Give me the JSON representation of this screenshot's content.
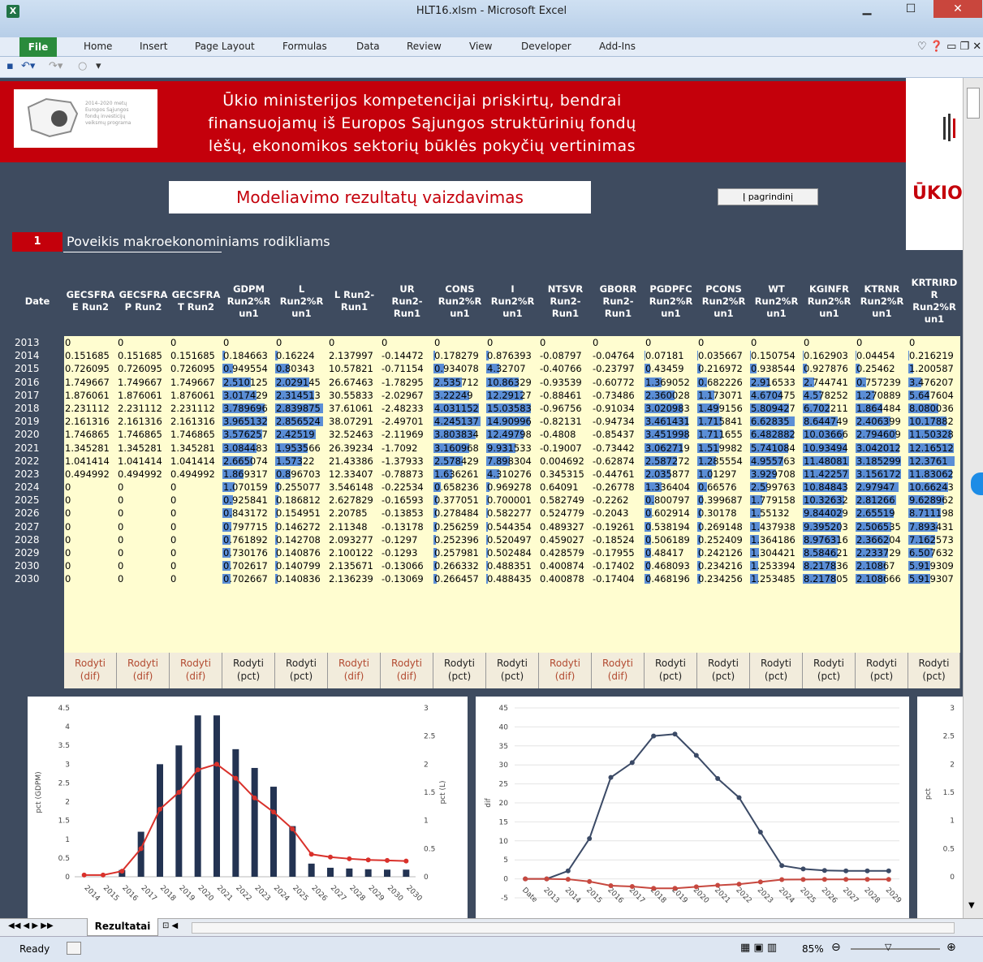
{
  "window": {
    "title": "HLT16.xlsm  -  Microsoft Excel"
  },
  "ribbon": {
    "file": "File",
    "tabs": [
      "Home",
      "Insert",
      "Page Layout",
      "Formulas",
      "Data",
      "Review",
      "View",
      "Developer",
      "Add-Ins"
    ]
  },
  "banner": {
    "logo_text": "2014–2020 metų\nEuropos Sąjungos\nfondų investicijų\nveiksmų programa",
    "title_line1": "Ūkio ministerijos kompetencijai priskirtų, bendrai",
    "title_line2": "finansuojamų iš Europos Sąjungos struktūrinių fondų",
    "title_line3": "lėšų, ekonomikos sektorių būklės pokyčių vertinimas",
    "right_logo_text": "ŪKIO"
  },
  "subtitle": "Modeliavimo rezultatų vaizdavimas",
  "back_button": "Į pagrindinį",
  "section": {
    "number": "1",
    "title": "Poveikis makroekonominiams rodikliams"
  },
  "table": {
    "date_header": "Date",
    "columns": [
      "GECSFRA\nE   Run2",
      "GECSFRA\nP    Run2",
      "GECSFRA\nT    Run2",
      "GDPM\nRun2%R\nun1",
      "L\nRun2%R\nun1",
      "L    Run2-\nRun1",
      "UR\nRun2-\nRun1",
      "CONS\nRun2%R\nun1",
      "I\nRun2%R\nun1",
      "NTSVR\nRun2-\nRun1",
      "GBORR\nRun2-\nRun1",
      "PGDPFC\nRun2%R\nun1",
      "PCONS\nRun2%R\nun1",
      "WT\nRun2%R\nun1",
      "KGINFR\nRun2%R\nun1",
      "KTRNR\nRun2%R\nun1",
      "KRTRIRD\nR\nRun2%R\nun1"
    ],
    "dates": [
      "2013",
      "2014",
      "2015",
      "2016",
      "2017",
      "2018",
      "2019",
      "2020",
      "2021",
      "2022",
      "2023",
      "2024",
      "2025",
      "2026",
      "2027",
      "2028",
      "2029",
      "2030",
      "2030"
    ],
    "rows": [
      [
        "0",
        "0",
        "0",
        "0",
        "0",
        "0",
        "0",
        "0",
        "0",
        "0",
        "0",
        "0",
        "0",
        "0",
        "0",
        "0",
        "0"
      ],
      [
        "0.151685",
        "0.151685",
        "0.151685",
        "0.184663",
        "0.16224",
        "2.137997",
        "-0.14472",
        "0.178279",
        "0.876393",
        "-0.08797",
        "-0.04764",
        "0.07181",
        "0.035667",
        "0.150754",
        "0.162903",
        "0.04454",
        "0.216219"
      ],
      [
        "0.726095",
        "0.726095",
        "0.726095",
        "0.949554",
        "0.80343",
        "10.57821",
        "-0.71154",
        "0.934078",
        "4.32707",
        "-0.40766",
        "-0.23797",
        "0.43459",
        "0.216972",
        "0.938544",
        "0.927876",
        "0.25462",
        "1.200587"
      ],
      [
        "1.749667",
        "1.749667",
        "1.749667",
        "2.510125",
        "2.029145",
        "26.67463",
        "-1.78295",
        "2.535712",
        "10.86329",
        "-0.93539",
        "-0.60772",
        "1.369052",
        "0.682226",
        "2.916533",
        "2.744741",
        "0.757239",
        "3.476207"
      ],
      [
        "1.876061",
        "1.876061",
        "1.876061",
        "3.017429",
        "2.314513",
        "30.55833",
        "-2.02967",
        "3.22249",
        "12.29127",
        "-0.88461",
        "-0.73486",
        "2.360028",
        "1.173071",
        "4.670475",
        "4.578252",
        "1.270889",
        "5.647604"
      ],
      [
        "2.231112",
        "2.231112",
        "2.231112",
        "3.789696",
        "2.839875",
        "37.61061",
        "-2.48233",
        "4.031152",
        "15.03583",
        "-0.96756",
        "-0.91034",
        "3.020983",
        "1.499156",
        "5.809427",
        "6.702211",
        "1.864484",
        "8.080036"
      ],
      [
        "2.161316",
        "2.161316",
        "2.161316",
        "3.965132",
        "2.856524",
        "38.07291",
        "-2.49701",
        "4.245137",
        "14.90996",
        "-0.82131",
        "-0.94734",
        "3.461431",
        "1.715841",
        "6.62835",
        "8.644749",
        "2.406399",
        "10.17882"
      ],
      [
        "1.746865",
        "1.746865",
        "1.746865",
        "3.576257",
        "2.42519",
        "32.52463",
        "-2.11969",
        "3.803834",
        "12.49798",
        "-0.4808",
        "-0.85437",
        "3.451998",
        "1.711655",
        "6.482882",
        "10.03666",
        "2.794609",
        "11.50328"
      ],
      [
        "1.345281",
        "1.345281",
        "1.345281",
        "3.084483",
        "1.953566",
        "26.39234",
        "-1.7092",
        "3.160968",
        "9.931533",
        "-0.19007",
        "-0.73442",
        "3.062719",
        "1.519982",
        "5.741084",
        "10.93494",
        "3.042012",
        "12.16512"
      ],
      [
        "1.041414",
        "1.041414",
        "1.041414",
        "2.665074",
        "1.57322",
        "21.43386",
        "-1.37933",
        "2.578429",
        "7.898304",
        "0.004692",
        "-0.62874",
        "2.587272",
        "1.285554",
        "4.955763",
        "11.48081",
        "3.185299",
        "12.3761"
      ],
      [
        "0.494992",
        "0.494992",
        "0.494992",
        "1.869317",
        "0.896703",
        "12.33407",
        "-0.78873",
        "1.636261",
        "4.310276",
        "0.345315",
        "-0.44761",
        "2.035877",
        "1.01297",
        "3.929708",
        "11.42257",
        "3.156172",
        "11.83062"
      ],
      [
        "0",
        "0",
        "0",
        "1.070159",
        "0.255077",
        "3.546148",
        "-0.22534",
        "0.658236",
        "0.969278",
        "0.64091",
        "-0.26778",
        "1.336404",
        "0.66576",
        "2.599763",
        "10.84843",
        "2.97947",
        "10.66243"
      ],
      [
        "0",
        "0",
        "0",
        "0.925841",
        "0.186812",
        "2.627829",
        "-0.16593",
        "0.377051",
        "0.700001",
        "0.582749",
        "-0.2262",
        "0.800797",
        "0.399687",
        "1.779158",
        "10.32632",
        "2.81266",
        "9.628962"
      ],
      [
        "0",
        "0",
        "0",
        "0.843172",
        "0.154951",
        "2.20785",
        "-0.13853",
        "0.278484",
        "0.582277",
        "0.524779",
        "-0.2043",
        "0.602914",
        "0.30178",
        "1.55132",
        "9.844029",
        "2.65519",
        "8.711198"
      ],
      [
        "0",
        "0",
        "0",
        "0.797715",
        "0.146272",
        "2.11348",
        "-0.13178",
        "0.256259",
        "0.544354",
        "0.489327",
        "-0.19261",
        "0.538194",
        "0.269148",
        "1.437938",
        "9.395203",
        "2.506535",
        "7.893431"
      ],
      [
        "0",
        "0",
        "0",
        "0.761892",
        "0.142708",
        "2.093277",
        "-0.1297",
        "0.252396",
        "0.520497",
        "0.459027",
        "-0.18524",
        "0.506189",
        "0.252409",
        "1.364186",
        "8.976316",
        "2.366204",
        "7.162573"
      ],
      [
        "0",
        "0",
        "0",
        "0.730176",
        "0.140876",
        "2.100122",
        "-0.1293",
        "0.257981",
        "0.502484",
        "0.428579",
        "-0.17955",
        "0.48417",
        "0.242126",
        "1.304421",
        "8.584621",
        "2.233729",
        "6.507632"
      ],
      [
        "0",
        "0",
        "0",
        "0.702617",
        "0.140799",
        "2.135671",
        "-0.13066",
        "0.266332",
        "0.488351",
        "0.400874",
        "-0.17402",
        "0.468093",
        "0.234216",
        "1.253394",
        "8.217836",
        "2.10867",
        "5.919309"
      ],
      [
        "0",
        "0",
        "0",
        "0.702667",
        "0.140836",
        "2.136239",
        "-0.13069",
        "0.266457",
        "0.488435",
        "0.400878",
        "-0.17404",
        "0.468196",
        "0.234256",
        "1.253485",
        "8.217805",
        "2.108666",
        "5.919307"
      ]
    ],
    "bar_columns": [
      3,
      4,
      7,
      8,
      11,
      12,
      13,
      14,
      15,
      16
    ],
    "bar_scale": {
      "3": 4.5,
      "4": 3.0,
      "7": 4.5,
      "8": 17,
      "11": 4,
      "12": 3.5,
      "13": 7.5,
      "14": 12.5,
      "15": 3.5,
      "16": 13.5
    },
    "bar_color": "#5b8ed6",
    "buttons": [
      [
        "Rodyti",
        "(dif)"
      ],
      [
        "Rodyti",
        "(dif)"
      ],
      [
        "Rodyti",
        "(dif)"
      ],
      [
        "Rodyti",
        "(pct)"
      ],
      [
        "Rodyti",
        "(pct)"
      ],
      [
        "Rodyti",
        "(dif)"
      ],
      [
        "Rodyti",
        "(dif)"
      ],
      [
        "Rodyti",
        "(pct)"
      ],
      [
        "Rodyti",
        "(pct)"
      ],
      [
        "Rodyti",
        "(dif)"
      ],
      [
        "Rodyti",
        "(dif)"
      ],
      [
        "Rodyti",
        "(pct)"
      ],
      [
        "Rodyti",
        "(pct)"
      ],
      [
        "Rodyti",
        "(pct)"
      ],
      [
        "Rodyti",
        "(pct)"
      ],
      [
        "Rodyti",
        "(pct)"
      ],
      [
        "Rodyti",
        "(pct)"
      ]
    ]
  },
  "chart_data": [
    {
      "type": "bar",
      "categories": [
        "2014",
        "2015",
        "2016",
        "2017",
        "2018",
        "2019",
        "2020",
        "2021",
        "2022",
        "2023",
        "2024",
        "2025",
        "2026",
        "2027",
        "2028",
        "2029",
        "2030",
        "2030"
      ],
      "series": [
        {
          "axis": "left",
          "kind": "bar",
          "values": [
            0,
            0,
            0.18,
            1.2,
            3.0,
            3.5,
            4.3,
            4.3,
            3.4,
            2.9,
            2.4,
            1.35,
            0.35,
            0.24,
            0.22,
            0.2,
            0.19,
            0.19
          ]
        },
        {
          "axis": "right",
          "kind": "line",
          "values": [
            0.03,
            0.03,
            0.1,
            0.5,
            1.2,
            1.5,
            1.9,
            2.0,
            1.75,
            1.4,
            1.15,
            0.85,
            0.4,
            0.35,
            0.32,
            0.3,
            0.29,
            0.28
          ]
        }
      ],
      "ylabel": "pct (GDPM)",
      "y2label": "pct (L)",
      "ylim": [
        0,
        4.5
      ],
      "y2lim": [
        0,
        3
      ],
      "yticks": [
        "0",
        "0.5",
        "1",
        "1.5",
        "2",
        "2.5",
        "3",
        "3.5",
        "4",
        "4.5"
      ],
      "y2ticks": [
        "0",
        "0.5",
        "1",
        "1.5",
        "2",
        "2.5",
        "3"
      ],
      "bar_color": "#233352",
      "line_color": "#d9312b"
    },
    {
      "type": "line",
      "categories": [
        "Date",
        "2013",
        "2014",
        "2015",
        "2016",
        "2017",
        "2018",
        "2019",
        "2020",
        "2021",
        "2022",
        "2023",
        "2024",
        "2025",
        "2026",
        "2027",
        "2028",
        "2029"
      ],
      "series": [
        {
          "values": [
            0,
            0,
            2.1,
            10.6,
            26.7,
            30.6,
            37.6,
            38.1,
            32.5,
            26.4,
            21.4,
            12.3,
            3.5,
            2.6,
            2.2,
            2.1,
            2.1,
            2.1
          ],
          "color": "#3b4a66"
        },
        {
          "values": [
            0,
            0,
            -0.1,
            -0.7,
            -1.8,
            -2.0,
            -2.5,
            -2.5,
            -2.1,
            -1.7,
            -1.4,
            -0.8,
            -0.2,
            -0.17,
            -0.14,
            -0.13,
            -0.13,
            -0.13
          ],
          "color": "#c7483f"
        }
      ],
      "ylabel": "dif",
      "ylim": [
        -5,
        45
      ],
      "yticks": [
        "-5",
        "0",
        "5",
        "10",
        "15",
        "20",
        "25",
        "30",
        "35",
        "40",
        "45"
      ]
    },
    {
      "type": "line",
      "ylabel": "pct",
      "y2ticks": [
        "0",
        "0.5",
        "1",
        "1.5",
        "2",
        "2.5",
        "3"
      ]
    }
  ],
  "sheet_tab": "Rezultatai",
  "status": {
    "ready": "Ready",
    "zoom": "85%"
  }
}
